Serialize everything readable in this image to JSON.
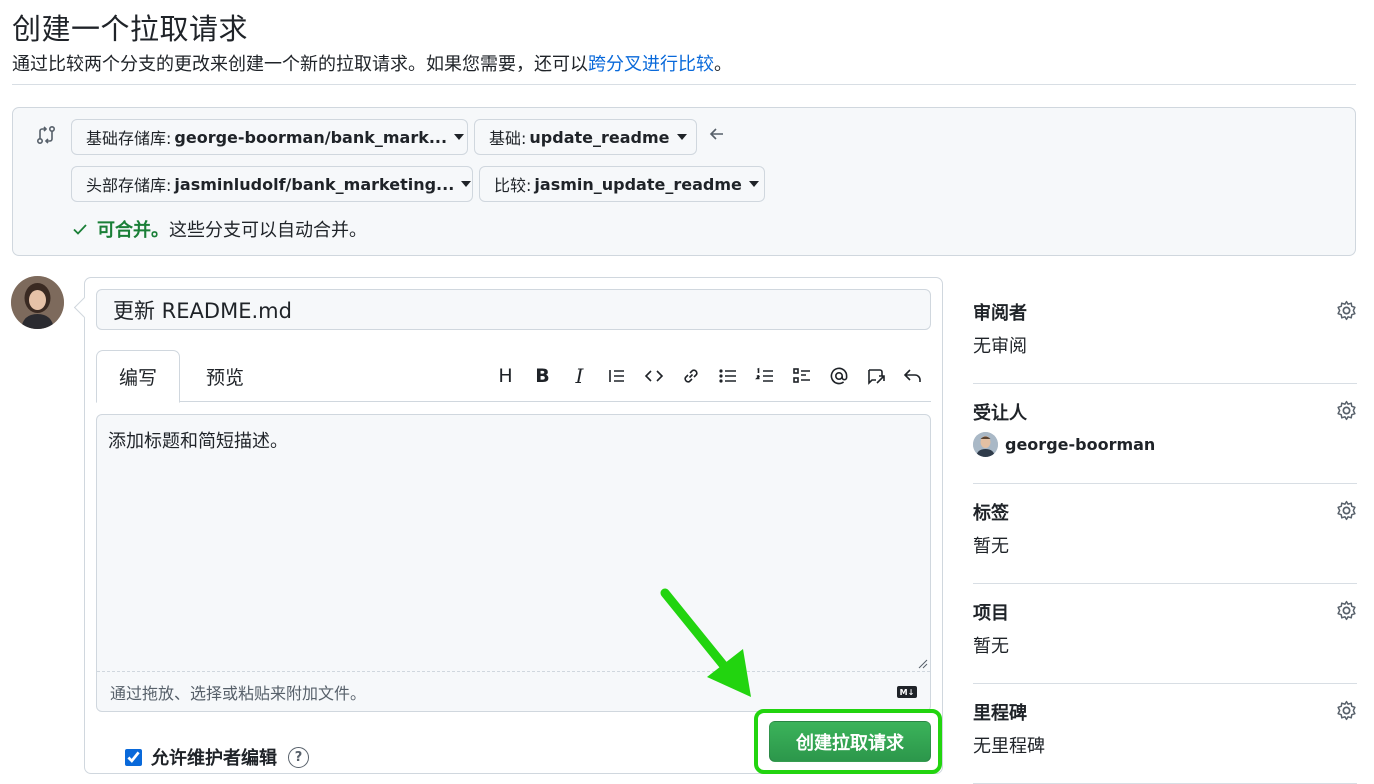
{
  "page": {
    "title": "创建一个拉取请求",
    "subtitle_prefix": "通过比较两个分支的更改来创建一个新的拉取请求。如果您需要，还可以",
    "subtitle_link": "跨分叉进行比较",
    "subtitle_suffix": "。"
  },
  "compare": {
    "base_repo_label": "基础存储库:",
    "base_repo_value": "george-boorman/bank_mark...",
    "base_label": "基础:",
    "base_value": "update_readme",
    "head_repo_label": "头部存储库:",
    "head_repo_value": "jasminludolf/bank_marketing...",
    "compare_label": "比较:",
    "compare_value": "jasmin_update_readme",
    "merge_ok": "可合并。",
    "merge_rest": "这些分支可以自动合并。"
  },
  "composer": {
    "title_value": "更新 README.md",
    "tab_write": "编写",
    "tab_preview": "预览",
    "body_placeholder": "添加标题和简短描述。",
    "attach_hint": "通过拖放、选择或粘贴来附加文件。",
    "md_badge": "M↓",
    "allow_edits": "允许维护者编辑",
    "help_glyph": "?",
    "create_button": "创建拉取请求"
  },
  "toolbar": {
    "heading_glyph": "H",
    "bold_glyph": "B",
    "italic_glyph": "I"
  },
  "sidebar": {
    "reviewers": {
      "header": "审阅者",
      "value": "无审阅"
    },
    "assignees": {
      "header": "受让人",
      "value": "george-boorman"
    },
    "labels": {
      "header": "标签",
      "value": "暂无"
    },
    "projects": {
      "header": "项目",
      "value": "暂无"
    },
    "milestone": {
      "header": "里程碑",
      "value": "无里程碑"
    }
  },
  "colors": {
    "accent_link": "#0969da",
    "success_green": "#1a7f37",
    "button_green": "#2ea44f",
    "highlight_green": "#22d40f"
  }
}
